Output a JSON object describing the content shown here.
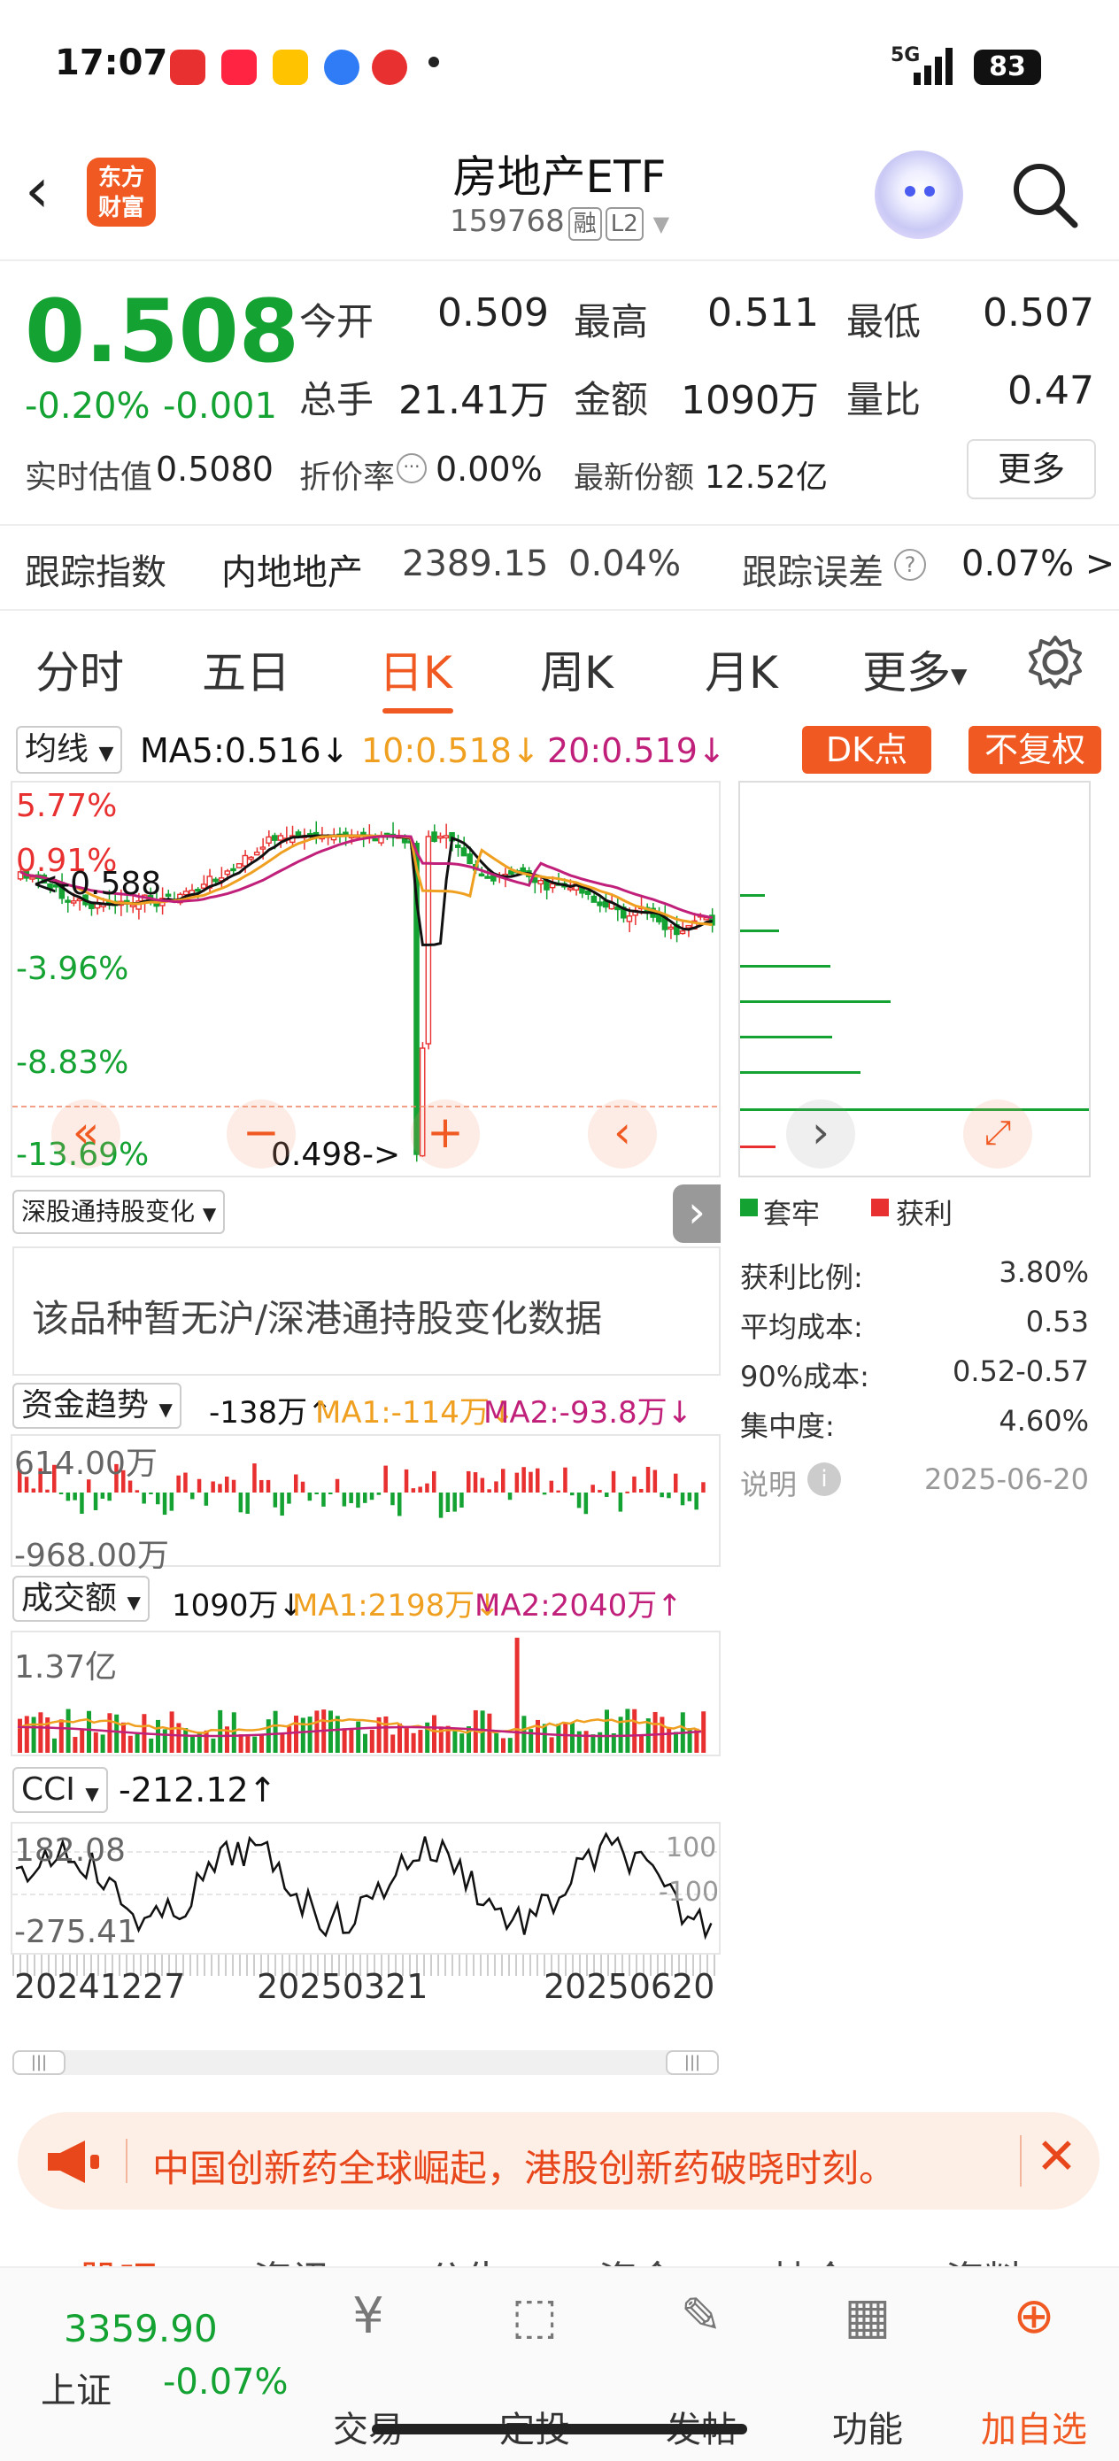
{
  "status": {
    "time": "17:07",
    "network": "5G",
    "battery": "83",
    "apps": [
      {
        "name": "toutiao-app-icon",
        "label": "头条",
        "color": "#e93030"
      },
      {
        "name": "xiaohongshu-app-icon",
        "label": "小红书",
        "color": "#ff2442"
      },
      {
        "name": "meituan-app-icon",
        "label": "美团",
        "color": "#ffc300"
      },
      {
        "name": "blue-app-icon",
        "label": "",
        "color": "#2f7cf6"
      },
      {
        "name": "netease-app-icon",
        "label": "",
        "color": "#e93030"
      }
    ]
  },
  "header": {
    "logo": "东方财富",
    "title": "房地产ETF",
    "code": "159768",
    "tag_margin": "融",
    "tag_level": "L2"
  },
  "quote": {
    "price": "0.508",
    "change_pct": "-0.20%",
    "change_abs": "-0.001",
    "open_label": "今开",
    "open": "0.509",
    "high_label": "最高",
    "high": "0.511",
    "low_label": "最低",
    "low": "0.507",
    "volume_label": "总手",
    "volume": "21.41万",
    "amount_label": "金额",
    "amount": "1090万",
    "ratio_label": "量比",
    "ratio": "0.47",
    "iopv_label": "实时估值",
    "iopv": "0.5080",
    "discount_label": "折价率",
    "discount": "0.00%",
    "shares_label": "最新份额",
    "shares": "12.52亿",
    "more_button": "更多"
  },
  "tracking": {
    "label": "跟踪指数",
    "index_name": "内地地产",
    "index_value": "2389.15",
    "index_change": "0.04%",
    "error_label": "跟踪误差",
    "error_value": "0.07% >"
  },
  "tabs": [
    "分时",
    "五日",
    "日K",
    "周K",
    "月K",
    "更多"
  ],
  "active_tab": "日K",
  "kline": {
    "ma_selector": "均线",
    "ma5": "MA5:0.516↓",
    "ma10": "10:0.518↓",
    "ma20": "20:0.519↓",
    "dk_button": "DK点",
    "adjust_button": "不复权",
    "pct_labels": [
      "5.77%",
      "0.91%",
      "-3.96%",
      "-8.83%",
      "-13.69%"
    ],
    "high_marker": "<-0.588",
    "low_marker": "0.498->",
    "colors": {
      "ma5": "#111111",
      "ma10": "#f0a020",
      "ma20": "#c0207a",
      "up": "#e93030",
      "down": "#14a232"
    },
    "chip_legend_hold": "套牢",
    "chip_legend_profit": "获利"
  },
  "chip_stats": {
    "profit_ratio_label": "获利比例:",
    "profit_ratio": "3.80%",
    "avg_cost_label": "平均成本:",
    "avg_cost": "0.53",
    "cost90_label": "90%成本:",
    "cost90": "0.52-0.57",
    "concentration_label": "集中度:",
    "concentration": "4.60%",
    "note_label": "说明",
    "date": "2025-06-20"
  },
  "hk_connect": {
    "selector": "深股通持股变化",
    "message": "该品种暂无沪/深港通持股变化数据"
  },
  "fund_flow": {
    "selector": "资金趋势",
    "value": "-138万↑",
    "ma1": "MA1:-114万↓",
    "ma2": "MA2:-93.8万↓",
    "max_label": "614.00万",
    "min_label": "-968.00万"
  },
  "turnover": {
    "selector": "成交额",
    "value": "1090万↓",
    "ma1": "MA1:2198万↓",
    "ma2": "MA2:2040万↑",
    "max_label": "1.37亿"
  },
  "cci": {
    "selector": "CCI",
    "value": "-212.12↑",
    "max_label": "182.08",
    "min_label": "-275.41",
    "ref_high": "100",
    "ref_low": "-100"
  },
  "dates": [
    "20241227",
    "20250321",
    "20250620"
  ],
  "notice": {
    "text": "中国创新药全球崛起，港股创新药破晓时刻。"
  },
  "bottom_tabs_partial": [
    "股吧",
    "资讯",
    "公告",
    "资金",
    "持仓",
    "资料"
  ],
  "bottom_nav": {
    "index_value": "3359.90",
    "index_name": "上证",
    "index_change": "-0.07%",
    "items": [
      "交易",
      "定投",
      "发帖",
      "功能",
      "加自选"
    ]
  }
}
